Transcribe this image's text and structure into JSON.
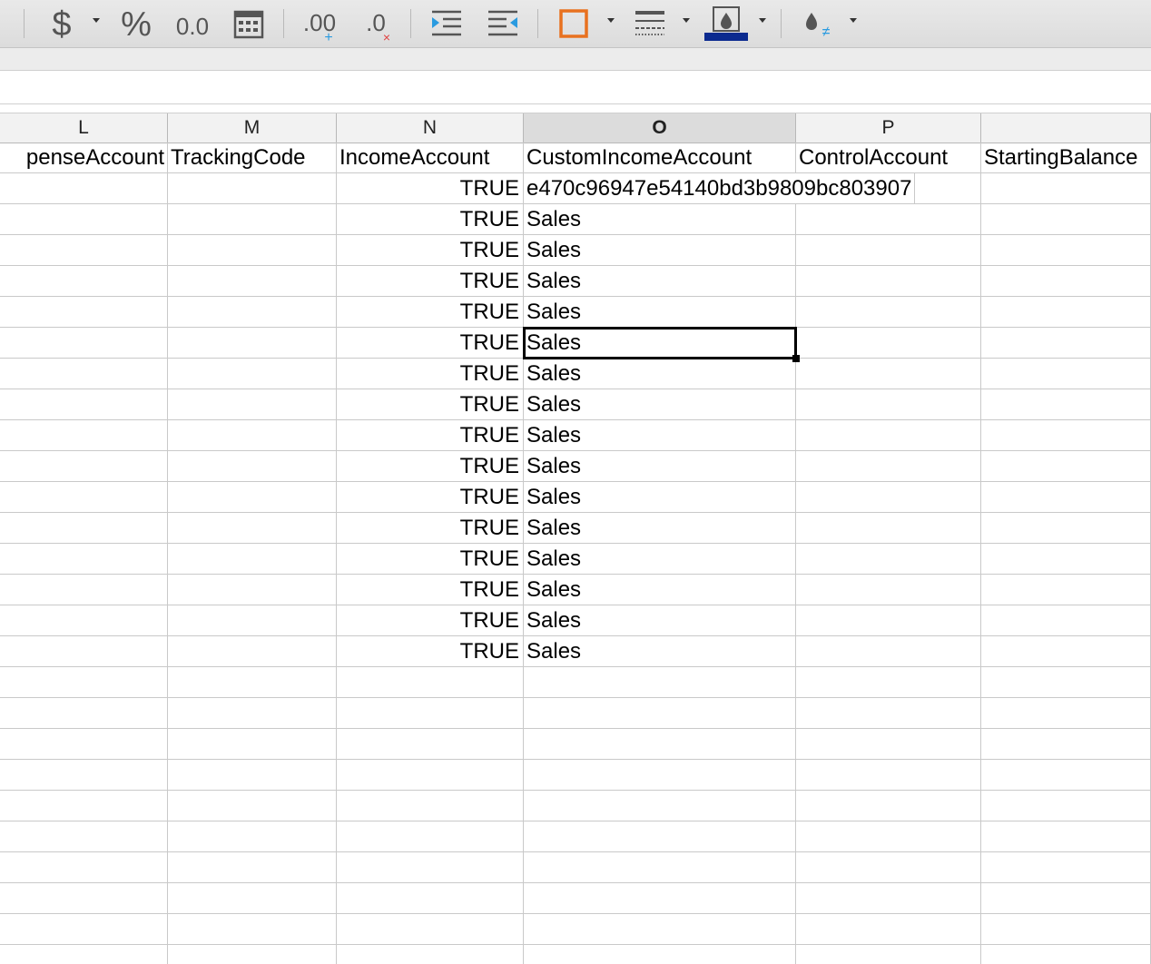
{
  "toolbar": {
    "buttons": [
      {
        "name": "currency-format-icon",
        "glyph": "$"
      },
      {
        "name": "percent-format-icon",
        "glyph": "%"
      },
      {
        "name": "number-format-icon",
        "glyph": "0.0"
      },
      {
        "name": "date-format-icon",
        "glyph": "calendar"
      },
      {
        "name": "add-decimal-icon",
        "glyph": ".00"
      },
      {
        "name": "delete-decimal-icon",
        "glyph": ".0"
      },
      {
        "name": "increase-indent-icon",
        "glyph": "indent"
      },
      {
        "name": "decrease-indent-icon",
        "glyph": "outdent"
      },
      {
        "name": "borders-icon",
        "glyph": "border"
      },
      {
        "name": "border-style-icon",
        "glyph": "lines"
      },
      {
        "name": "border-color-icon",
        "glyph": "drop"
      },
      {
        "name": "conditional-format-icon",
        "glyph": "drop-neq"
      }
    ],
    "border_color": "#e8711f",
    "border_line_color": "#0b2a8f"
  },
  "columns": [
    {
      "id": "L",
      "label": "L",
      "selected": false
    },
    {
      "id": "M",
      "label": "M",
      "selected": false
    },
    {
      "id": "N",
      "label": "N",
      "selected": false
    },
    {
      "id": "O",
      "label": "O",
      "selected": true
    },
    {
      "id": "P",
      "label": "P",
      "selected": false
    },
    {
      "id": "Q",
      "label": "",
      "selected": false
    }
  ],
  "header_row": [
    "penseAccount",
    "TrackingCode",
    "IncomeAccount",
    "CustomIncomeAccount",
    "ControlAccount",
    "StartingBalance"
  ],
  "rows": [
    [
      "",
      "",
      "TRUE",
      "e470c96947e54140bd3b9809bc803907",
      "",
      ""
    ],
    [
      "",
      "",
      "TRUE",
      "Sales",
      "",
      ""
    ],
    [
      "",
      "",
      "TRUE",
      "Sales",
      "",
      ""
    ],
    [
      "",
      "",
      "TRUE",
      "Sales",
      "",
      ""
    ],
    [
      "",
      "",
      "TRUE",
      "Sales",
      "",
      ""
    ],
    [
      "",
      "",
      "TRUE",
      "Sales",
      "",
      ""
    ],
    [
      "",
      "",
      "TRUE",
      "Sales",
      "",
      ""
    ],
    [
      "",
      "",
      "TRUE",
      "Sales",
      "",
      ""
    ],
    [
      "",
      "",
      "TRUE",
      "Sales",
      "",
      ""
    ],
    [
      "",
      "",
      "TRUE",
      "Sales",
      "",
      ""
    ],
    [
      "",
      "",
      "TRUE",
      "Sales",
      "",
      ""
    ],
    [
      "",
      "",
      "TRUE",
      "Sales",
      "",
      ""
    ],
    [
      "",
      "",
      "TRUE",
      "Sales",
      "",
      ""
    ],
    [
      "",
      "",
      "TRUE",
      "Sales",
      "",
      ""
    ],
    [
      "",
      "",
      "TRUE",
      "Sales",
      "",
      ""
    ],
    [
      "",
      "",
      "TRUE",
      "Sales",
      "",
      ""
    ]
  ],
  "active_cell": {
    "row": 6,
    "col": 3
  },
  "empty_rows": 10
}
